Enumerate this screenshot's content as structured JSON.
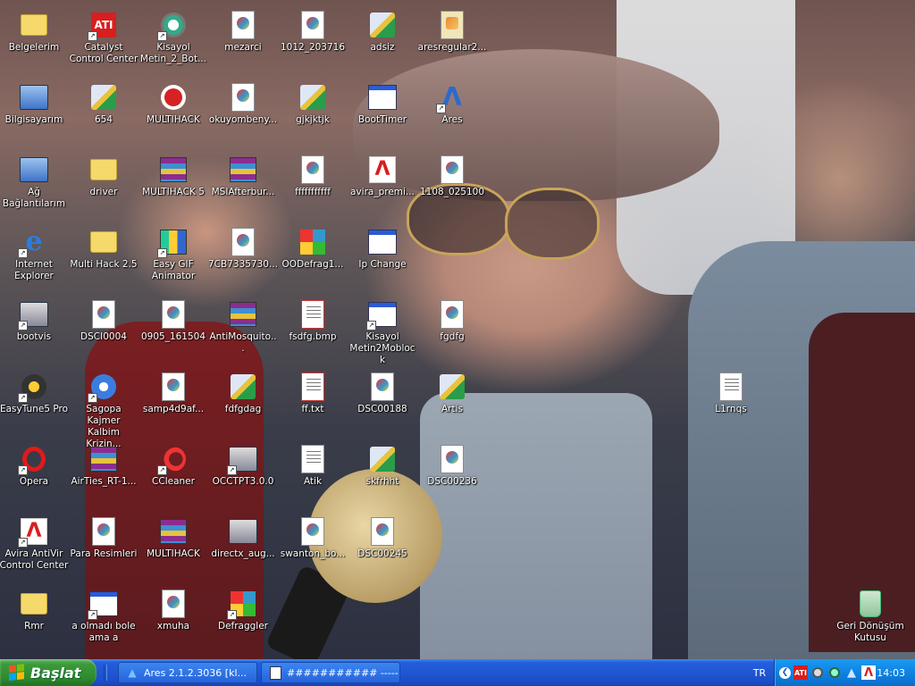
{
  "desktop": {
    "icons": [
      {
        "label": "Belgelerim",
        "icon": "my-documents-folder-icon"
      },
      {
        "label": "Catalyst\nControl Center",
        "icon": "ati-icon"
      },
      {
        "label": "Kisayol\nMetin_2_Bot...",
        "icon": "bot-icon"
      },
      {
        "label": "mezarci",
        "icon": "image-file-icon"
      },
      {
        "label": "1012_203716",
        "icon": "image-file-icon"
      },
      {
        "label": "adsiz",
        "icon": "paint-icon"
      },
      {
        "label": "aresregular2...",
        "icon": "installer-icon"
      },
      {
        "label": "Bilgisayarım",
        "icon": "my-computer-icon"
      },
      {
        "label": "654",
        "icon": "paint-icon"
      },
      {
        "label": "MULTIHACK",
        "icon": "power-icon"
      },
      {
        "label": "okuyombeny...",
        "icon": "image-file-icon"
      },
      {
        "label": "gjkjktjk",
        "icon": "paint-icon"
      },
      {
        "label": "BootTimer",
        "icon": "window-icon"
      },
      {
        "label": "Ares",
        "icon": "ares-icon"
      },
      {
        "label": "Ağ\nBağlantılarım",
        "icon": "network-icon"
      },
      {
        "label": "driver",
        "icon": "folder-icon"
      },
      {
        "label": "MULTIHACK 5",
        "icon": "winrar-icon"
      },
      {
        "label": "MSIAfterbur...",
        "icon": "winrar-icon"
      },
      {
        "label": "fffffffffff",
        "icon": "image-file-icon"
      },
      {
        "label": "avira_premi...",
        "icon": "avira-icon"
      },
      {
        "label": "1108_025100",
        "icon": "image-file-icon"
      },
      {
        "label": "Internet\nExplorer",
        "icon": "internet-explorer-icon"
      },
      {
        "label": "Multi Hack 2.5",
        "icon": "folder-icon"
      },
      {
        "label": "Easy GIF\nAnimator",
        "icon": "gif-animator-icon"
      },
      {
        "label": "7CB7335730...",
        "icon": "image-file-icon"
      },
      {
        "label": "OODefrag1...",
        "icon": "defrag-icon"
      },
      {
        "label": "Ip Change",
        "icon": "window-gear-icon"
      },
      {
        "label": "bootvis",
        "icon": "bootvis-icon"
      },
      {
        "label": "DSCI0004",
        "icon": "image-file-icon"
      },
      {
        "label": "0905_161504",
        "icon": "image-file-icon"
      },
      {
        "label": "AntiMosquito...",
        "icon": "winrar-icon"
      },
      {
        "label": "fsdfg.bmp",
        "icon": "blocked-file-icon"
      },
      {
        "label": "Kisayol\nMetin2Moblock",
        "icon": "window-gear-icon"
      },
      {
        "label": "fgdfg",
        "icon": "image-file-icon"
      },
      {
        "label": "EasyTune5 Pro",
        "icon": "easytune-icon"
      },
      {
        "label": "Sagopa Kajmer\nKalbim Krizin...",
        "icon": "media-player-icon"
      },
      {
        "label": "samp4d9af...",
        "icon": "image-file-icon"
      },
      {
        "label": "fdfgdag",
        "icon": "paint-icon"
      },
      {
        "label": "ff.txt",
        "icon": "blocked-file-icon"
      },
      {
        "label": "DSC00188",
        "icon": "image-file-icon"
      },
      {
        "label": "Artis",
        "icon": "paint-icon"
      },
      {
        "label": "L1rnqs",
        "icon": "text-file-icon"
      },
      {
        "label": "Opera",
        "icon": "opera-icon"
      },
      {
        "label": "AirTies_RT-1...",
        "icon": "winrar-icon"
      },
      {
        "label": "CCleaner",
        "icon": "ccleaner-icon"
      },
      {
        "label": "OCCTPT3.0.0",
        "icon": "occt-icon"
      },
      {
        "label": "Atik",
        "icon": "text-file-icon"
      },
      {
        "label": "skfrhht",
        "icon": "paint-icon"
      },
      {
        "label": "DSC00236",
        "icon": "image-file-icon"
      },
      {
        "label": "Avira AntiVir\nControl Center",
        "icon": "avira-icon"
      },
      {
        "label": "Para Resimleri",
        "icon": "image-file-icon"
      },
      {
        "label": "MULTIHACK",
        "icon": "winrar-icon"
      },
      {
        "label": "directx_aug...",
        "icon": "directx-icon"
      },
      {
        "label": "swanton_bo...",
        "icon": "image-file-icon"
      },
      {
        "label": "DSC00245",
        "icon": "image-file-icon"
      },
      {
        "label": "Rmr",
        "icon": "folder-icon"
      },
      {
        "label": "a olmadı bole\nama a",
        "icon": "window-icon"
      },
      {
        "label": "xmuha",
        "icon": "image-file-icon"
      },
      {
        "label": "Defraggler",
        "icon": "defraggler-icon"
      },
      {
        "label": "Geri Dönüşüm\nKutusu",
        "icon": "recycle-bin-icon"
      }
    ]
  },
  "taskbar": {
    "start_label": "Başlat",
    "tasks": [
      {
        "label": "Ares 2.1.2.3036  [kl...",
        "icon": "ares-icon"
      },
      {
        "label": "########### -----...",
        "icon": "notepad-icon"
      }
    ],
    "language": "TR",
    "tray_icons": [
      "show-hidden-icon",
      "ati-tray-icon",
      "tray-icon-3",
      "tray-icon-4",
      "ares-tray-icon",
      "avira-tray-icon"
    ],
    "clock": "14:03"
  }
}
